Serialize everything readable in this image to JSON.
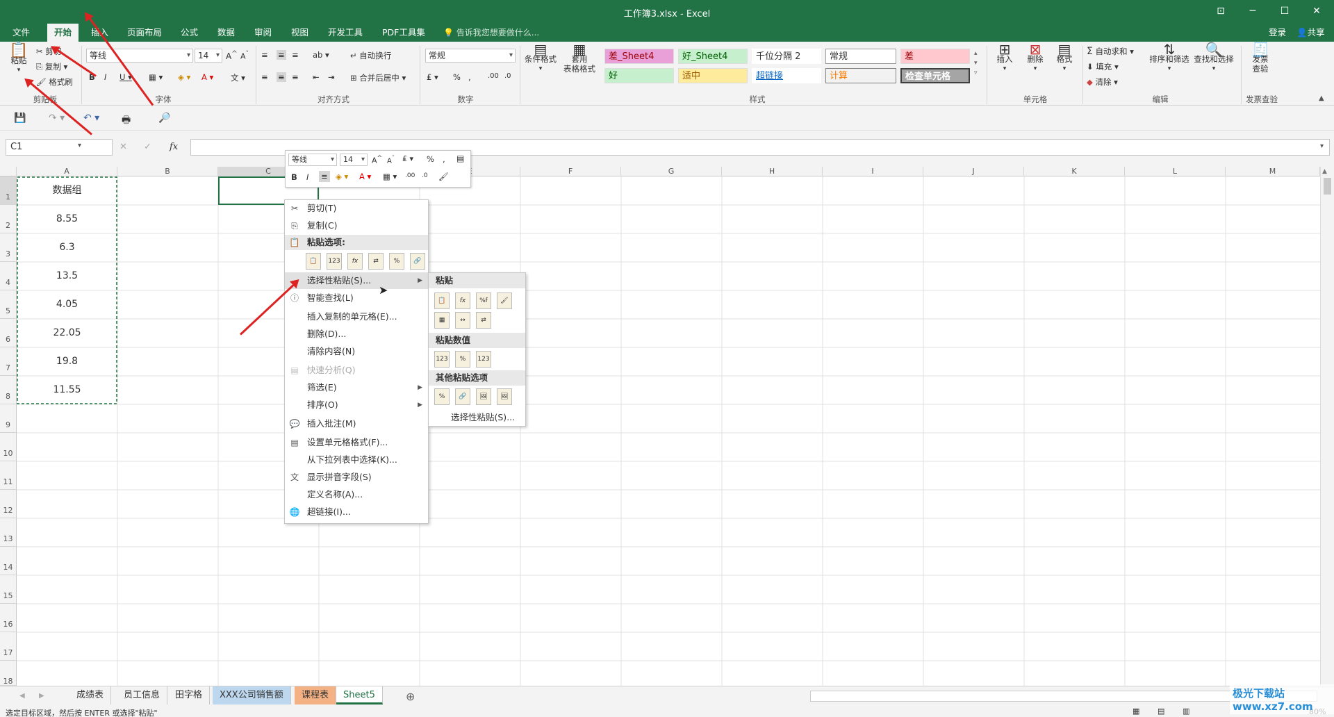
{
  "window": {
    "title": "工作簿3.xlsx - Excel",
    "login": "登录",
    "share": "共享"
  },
  "tabs": [
    "文件",
    "开始",
    "插入",
    "页面布局",
    "公式",
    "数据",
    "审阅",
    "视图",
    "开发工具",
    "PDF工具集"
  ],
  "tell_me": "告诉我您想要做什么...",
  "ribbon": {
    "clipboard": {
      "paste": "粘贴",
      "cut": "剪切",
      "copy": "复制",
      "format_painter": "格式刷",
      "label": "剪贴板"
    },
    "font": {
      "name": "等线",
      "size": "14",
      "label": "字体"
    },
    "alignment": {
      "wrap": "自动换行",
      "merge": "合并后居中",
      "label": "对齐方式"
    },
    "number": {
      "format": "常规",
      "label": "数字"
    },
    "styles": {
      "cond_format": "条件格式",
      "table_format": "套用\n表格格式",
      "cells_styles": [
        "差_Sheet4",
        "好_Sheet4",
        "千位分隔 2",
        "常规",
        "差",
        "好",
        "适中",
        "超链接",
        "计算",
        "检查单元格"
      ],
      "label": "样式"
    },
    "cells": {
      "insert": "插入",
      "delete": "删除",
      "format": "格式",
      "label": "单元格"
    },
    "editing": {
      "autosum": "自动求和",
      "fill": "填充",
      "clear": "清除",
      "sort": "排序和筛选",
      "find": "查找和选择",
      "label": "编辑"
    },
    "invoice": {
      "check": "发票\n查验",
      "label": "发票查验"
    }
  },
  "formula_bar": {
    "name_box": "C1",
    "fx": "fx",
    "formula": ""
  },
  "columns": [
    "A",
    "B",
    "C",
    "D",
    "E",
    "F",
    "G",
    "H",
    "I",
    "J",
    "K",
    "L",
    "M"
  ],
  "rows": [
    "1",
    "2",
    "3",
    "4",
    "5",
    "6",
    "7",
    "8",
    "9",
    "10",
    "11",
    "12",
    "13",
    "14",
    "15",
    "16",
    "17",
    "18"
  ],
  "cells_A": [
    "数据组",
    "8.55",
    "6.3",
    "13.5",
    "4.05",
    "22.05",
    "19.8",
    "11.55"
  ],
  "mini_toolbar": {
    "font": "等线",
    "size": "14"
  },
  "context_menu": {
    "cut": "剪切(T)",
    "copy": "复制(C)",
    "paste_options": "粘贴选项:",
    "paste_special": "选择性粘贴(S)...",
    "smart_lookup": "智能查找(L)",
    "insert_copied": "插入复制的单元格(E)...",
    "delete": "删除(D)...",
    "clear": "清除内容(N)",
    "quick_analysis": "快速分析(Q)",
    "filter": "筛选(E)",
    "sort": "排序(O)",
    "insert_comment": "插入批注(M)",
    "format_cells": "设置单元格格式(F)...",
    "pick_list": "从下拉列表中选择(K)...",
    "phonetic": "显示拼音字段(S)",
    "define_name": "定义名称(A)...",
    "hyperlink": "超链接(I)..."
  },
  "submenu": {
    "paste": "粘贴",
    "paste_values": "粘贴数值",
    "other_paste": "其他粘贴选项",
    "paste_special": "选择性粘贴(S)..."
  },
  "sheet_tabs": [
    "成绩表",
    "员工信息",
    "田字格",
    "XXX公司销售额",
    "课程表",
    "Sheet5"
  ],
  "status": "选定目标区域，然后按 ENTER 或选择\"粘贴\"",
  "zoom": "80%",
  "watermark": "极光下载站 www.xz7.com"
}
